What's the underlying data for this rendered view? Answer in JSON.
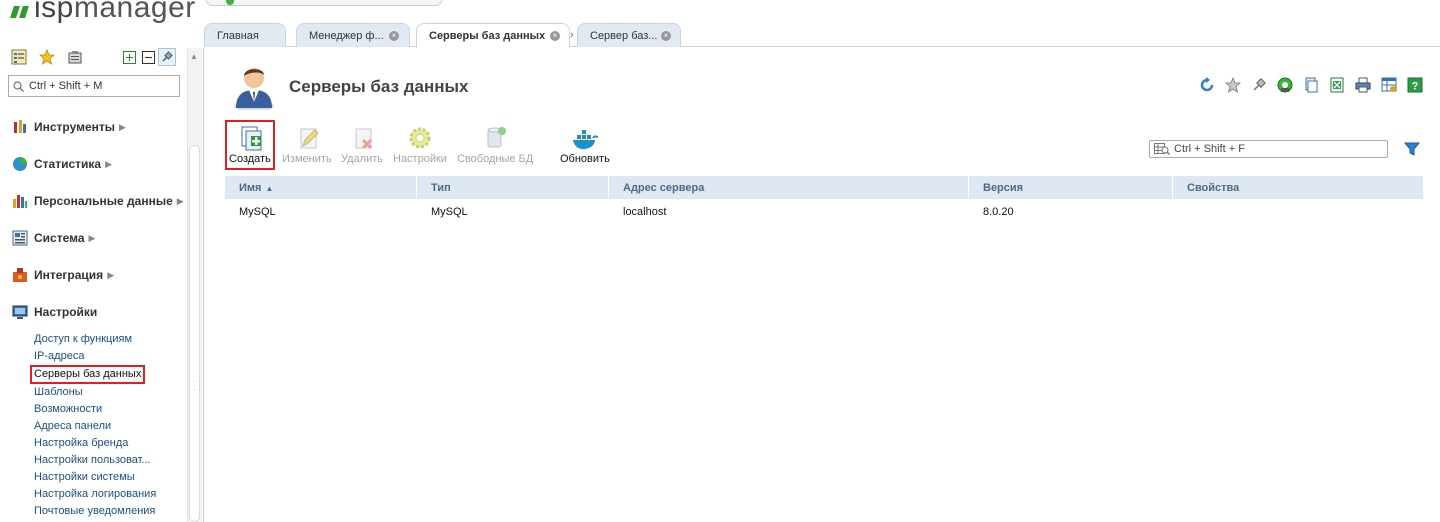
{
  "logo": {
    "prefix": "isp",
    "suffix": "manager"
  },
  "left": {
    "search_placeholder": "Ctrl + Shift + M",
    "sections": [
      {
        "label": "Инструменты"
      },
      {
        "label": "Статистика"
      },
      {
        "label": "Персональные данные"
      },
      {
        "label": "Система"
      },
      {
        "label": "Интеграция"
      },
      {
        "label": "Настройки"
      }
    ],
    "settings_items": [
      {
        "label": "Доступ к функциям"
      },
      {
        "label": "IP-адреса"
      },
      {
        "label": "Серверы баз данных",
        "active": true
      },
      {
        "label": "Шаблоны"
      },
      {
        "label": "Возможности"
      },
      {
        "label": "Адреса панели"
      },
      {
        "label": "Настройка бренда"
      },
      {
        "label": "Настройки пользоват..."
      },
      {
        "label": "Настройки системы"
      },
      {
        "label": "Настройка логирования"
      },
      {
        "label": "Почтовые уведомления"
      }
    ]
  },
  "tabs": [
    {
      "label": "Главная"
    },
    {
      "label": "Менеджер ф..."
    },
    {
      "label": "Серверы баз данных",
      "active": true
    },
    {
      "label": "Сервер баз..."
    }
  ],
  "page": {
    "title": "Серверы баз данных"
  },
  "toolbar": {
    "create": "Создать",
    "edit": "Изменить",
    "delete": "Удалить",
    "settings": "Настройки",
    "free_db": "Свободные БД",
    "refresh": "Обновить"
  },
  "table": {
    "search_placeholder": "Ctrl + Shift + F",
    "columns": [
      "Имя",
      "Тип",
      "Адрес сервера",
      "Версия",
      "Свойства"
    ],
    "rows": [
      {
        "name": "MySQL",
        "type": "MySQL",
        "address": "localhost",
        "version": "8.0.20",
        "props": ""
      }
    ]
  },
  "colors": {
    "accent": "#1a4f8b",
    "highlight": "#e02020",
    "header_bg": "#dde8f2",
    "logo_green": "#2e9b2e"
  }
}
